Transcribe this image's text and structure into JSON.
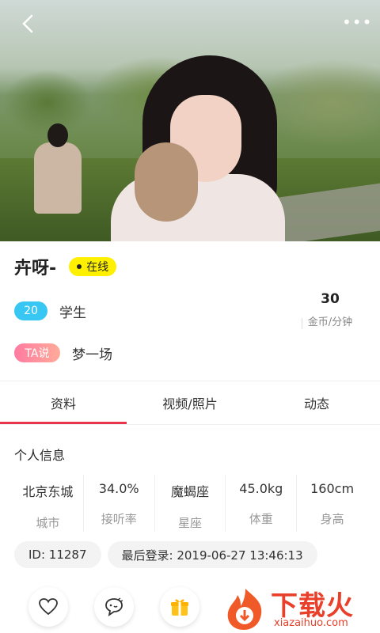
{
  "profile": {
    "name": "卉呀-",
    "status": "在线",
    "age": "20",
    "occupation": "学生",
    "ta_label": "TA说",
    "motto": "梦一场",
    "price": {
      "value": "30",
      "unit": "金币/分钟"
    }
  },
  "tabs": [
    {
      "label": "资料",
      "active": true
    },
    {
      "label": "视频/照片",
      "active": false
    },
    {
      "label": "动态",
      "active": false
    }
  ],
  "section": {
    "title": "个人信息"
  },
  "stats": [
    {
      "value": "北京东城",
      "label": "城市"
    },
    {
      "value": "34.0%",
      "label": "接听率"
    },
    {
      "value": "魔蝎座",
      "label": "星座"
    },
    {
      "value": "45.0kg",
      "label": "体重"
    },
    {
      "value": "160cm",
      "label": "身高"
    }
  ],
  "chips": {
    "id": "ID: 11287",
    "last_login": "最后登录: 2019-06-27 13:46:13"
  },
  "actions": [
    {
      "icon": "heart-icon"
    },
    {
      "icon": "chat-bubble-icon"
    },
    {
      "icon": "gift-icon"
    }
  ],
  "watermark": {
    "text": "下载火",
    "sub": "xiazaihuo.com"
  },
  "colors": {
    "accent": "#e8344d",
    "online": "#fff000",
    "age": "#38c6f2"
  }
}
